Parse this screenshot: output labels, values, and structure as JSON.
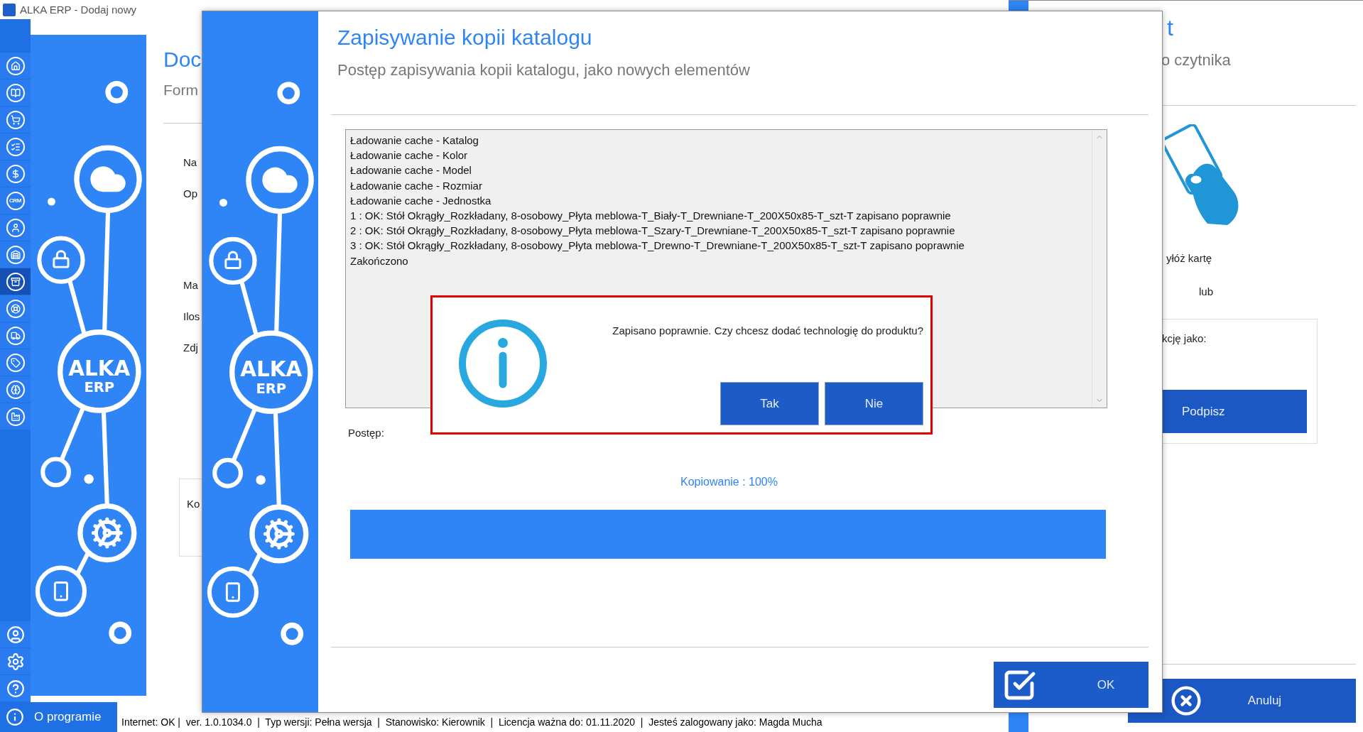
{
  "title_bar": {
    "title": "ALKA ERP - Dodaj nowy"
  },
  "nav_rail": {
    "items": [
      {
        "selected": false
      },
      {
        "selected": false
      },
      {
        "selected": false
      },
      {
        "selected": false
      },
      {
        "selected": false
      },
      {
        "selected": false,
        "label": "CRM"
      },
      {
        "selected": false
      },
      {
        "selected": false
      },
      {
        "selected": true
      },
      {
        "selected": false
      },
      {
        "selected": false
      },
      {
        "selected": false
      },
      {
        "selected": false
      },
      {
        "selected": false
      }
    ],
    "bottom_items": [
      {
        "selected": false
      },
      {
        "selected": false
      },
      {
        "selected": false
      }
    ],
    "about": "O programie"
  },
  "form_window": {
    "title": "Doc",
    "subtitle": "Form",
    "fields": [
      "Na",
      "Op",
      "Ma",
      "Ilos",
      "Zdj"
    ],
    "box_label": "Ko",
    "logo": [
      "ALKA",
      "ERP"
    ]
  },
  "reader_window": {
    "title": "t",
    "subtitle": "o czytnika",
    "prompt": "yłóż kartę",
    "or": "lub",
    "sign_label": "kcję jako:",
    "sign_button": "Podpisz",
    "cancel_button": "Anuluj"
  },
  "copy_dialog": {
    "title": "Zapisywanie kopii katalogu",
    "subtitle": "Postęp zapisywania kopii katalogu, jako nowych elementów",
    "logo": [
      "ALKA",
      "ERP"
    ],
    "log": [
      "Ładowanie cache - Katalog",
      "Ładowanie cache - Kolor",
      "Ładowanie cache - Model",
      "Ładowanie cache - Rozmiar",
      "Ładowanie cache - Jednostka",
      "1 : OK: Stół Okrągły_Rozkładany, 8-osobowy_Płyta meblowa-T_Biały-T_Drewniane-T_200X50x85-T_szt-T zapisano poprawnie",
      "2 : OK: Stół Okrągły_Rozkładany, 8-osobowy_Płyta meblowa-T_Szary-T_Drewniane-T_200X50x85-T_szt-T zapisano poprawnie",
      "3 : OK: Stół Okrągły_Rozkładany, 8-osobowy_Płyta meblowa-T_Drewno-T_Drewniane-T_200X50x85-T_szt-T zapisano poprawnie",
      "Zakończono"
    ],
    "progress_label": "Postęp:",
    "progress_text": "Kopiowanie : 100%",
    "progress": {
      "level": 1
    },
    "ok_button": "OK"
  },
  "message_box": {
    "message": "Zapisano poprawnie. Czy chcesz dodać technologię do produktu?",
    "buttons": [
      "Tak",
      "Nie"
    ]
  },
  "status_bar": {
    "text": "Internet: OK |  ver. 1.0.1034.0  |  Typ wersji: Pełna wersja  |  Stanowisko: Kierownik  |  Licencja ważna do: 01.11.2020  |  Jesteś zalogowany jako: Magda Mucha"
  }
}
